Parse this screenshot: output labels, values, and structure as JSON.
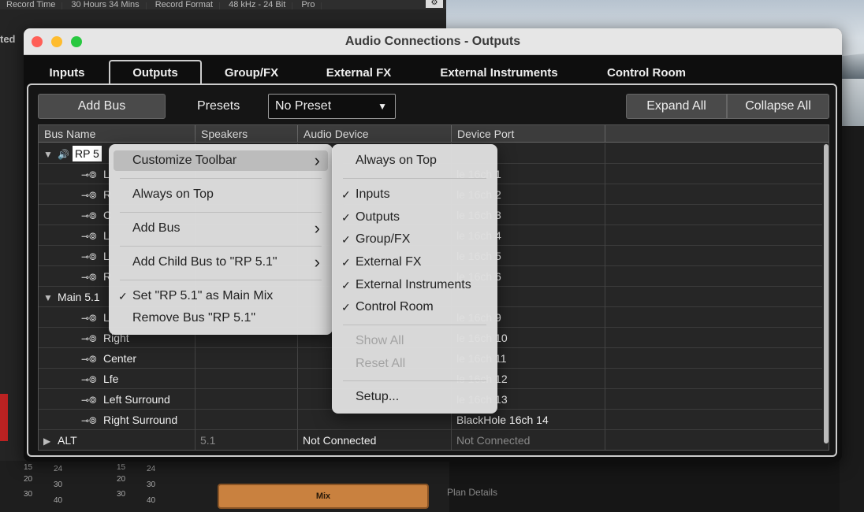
{
  "background": {
    "topbar_items": [
      "Record Time",
      "30 Hours 34 Mins",
      "Record Format",
      "48 kHz - 24 Bit",
      "Pro"
    ],
    "side_text": "ted",
    "mix_button": "Mix",
    "plan_details": "Plan Details",
    "scale_labels": [
      "15",
      "20",
      "30",
      "24",
      "30",
      "40",
      "15",
      "20",
      "30",
      "24",
      "30",
      "40"
    ]
  },
  "window": {
    "title": "Audio Connections - Outputs",
    "tabs": [
      {
        "label": "Inputs"
      },
      {
        "label": "Outputs"
      },
      {
        "label": "Group/FX"
      },
      {
        "label": "External FX"
      },
      {
        "label": "External Instruments"
      },
      {
        "label": "Control Room"
      }
    ],
    "active_tab": "Outputs"
  },
  "toolbar": {
    "add_bus": "Add Bus",
    "presets_label": "Presets",
    "preset_value": "No Preset",
    "expand_all": "Expand All",
    "collapse_all": "Collapse All"
  },
  "table": {
    "columns": [
      "Bus Name",
      "Speakers",
      "Audio Device",
      "Device Port"
    ],
    "rows": [
      {
        "name": "RP 5",
        "speakers": "",
        "device": "",
        "port": "",
        "level": 0,
        "expanded": true,
        "editing": true
      },
      {
        "name": "L",
        "speakers": "",
        "device": "",
        "port": "le 16ch 1",
        "level": 1
      },
      {
        "name": "R",
        "speakers": "",
        "device": "",
        "port": "le 16ch 2",
        "level": 1
      },
      {
        "name": "C",
        "speakers": "",
        "device": "",
        "port": "le 16ch 3",
        "level": 1
      },
      {
        "name": "L",
        "speakers": "",
        "device": "",
        "port": "le 16ch 4",
        "level": 1
      },
      {
        "name": "L",
        "speakers": "",
        "device": "",
        "port": "le 16ch 5",
        "level": 1
      },
      {
        "name": "R",
        "speakers": "",
        "device": "",
        "port": "le 16ch 6",
        "level": 1
      },
      {
        "name": "Main 5.1",
        "speakers": "",
        "device": "",
        "port": "",
        "level": 0,
        "expanded": true
      },
      {
        "name": "L",
        "speakers": "",
        "device": "",
        "port": "le 16ch 9",
        "level": 1
      },
      {
        "name": "Right",
        "speakers": "",
        "device": "",
        "port": "le 16ch 10",
        "level": 1
      },
      {
        "name": "Center",
        "speakers": "",
        "device": "",
        "port": "le 16ch 11",
        "level": 1
      },
      {
        "name": "Lfe",
        "speakers": "",
        "device": "",
        "port": "le 16ch 12",
        "level": 1
      },
      {
        "name": "Left Surround",
        "speakers": "",
        "device": "",
        "port": "le 16ch 13",
        "level": 1
      },
      {
        "name": "Right Surround",
        "speakers": "",
        "device": "",
        "port": "BlackHole 16ch 14",
        "level": 1
      },
      {
        "name": "ALT",
        "speakers": "5.1",
        "device": "Not Connected",
        "port": "Not Connected",
        "level": 0,
        "expanded": false
      }
    ]
  },
  "context_menu": {
    "items": [
      {
        "label": "Customize Toolbar",
        "submenu": true,
        "highlighted": true
      },
      {
        "label": "Always on Top"
      },
      {
        "label": "Add Bus",
        "submenu": true
      },
      {
        "label": "Add Child Bus to \"RP 5.1\"",
        "submenu": true
      },
      {
        "label": "Set \"RP 5.1\" as Main Mix",
        "checked": true
      },
      {
        "label": "Remove Bus \"RP 5.1\""
      }
    ]
  },
  "submenu": {
    "items": [
      {
        "label": "Always on Top"
      },
      {
        "label": "Inputs",
        "checked": true
      },
      {
        "label": "Outputs",
        "checked": true
      },
      {
        "label": "Group/FX",
        "checked": true
      },
      {
        "label": "External FX",
        "checked": true
      },
      {
        "label": "External Instruments",
        "checked": true
      },
      {
        "label": "Control Room",
        "checked": true
      },
      {
        "label": "Show All",
        "disabled": true
      },
      {
        "label": "Reset All",
        "disabled": true
      },
      {
        "label": "Setup..."
      }
    ]
  },
  "colors": {
    "close": "#ff5f57",
    "minimize": "#febc2e",
    "zoom": "#28c840",
    "mix_button": "#c9813f"
  }
}
